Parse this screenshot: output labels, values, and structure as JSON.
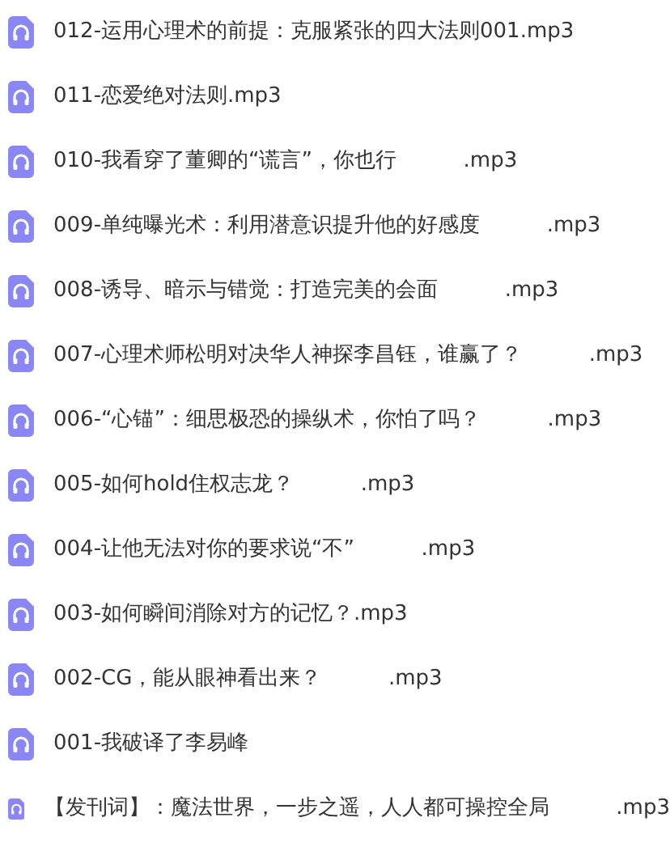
{
  "files": [
    {
      "name": "012-运用心理术的前提：克服紧张的四大法则001.mp3"
    },
    {
      "name": "011-恋爱绝对法则.mp3"
    },
    {
      "name": "010-我看穿了董卿的“谎言”，你也行          .mp3"
    },
    {
      "name": "009-单纯曝光术：利用潜意识提升他的好感度          .mp3"
    },
    {
      "name": "008-诱导、暗示与错觉：打造完美的会面          .mp3"
    },
    {
      "name": "007-心理术师松明对决华人神探李昌钰，谁赢了？          .mp3"
    },
    {
      "name": "006-“心锚”：细思极恐的操纵术，你怕了吗？          .mp3"
    },
    {
      "name": "005-如何hold住权志龙？          .mp3"
    },
    {
      "name": "004-让他无法对你的要求说“不”          .mp3"
    },
    {
      "name": "003-如何瞬间消除对方的记忆？.mp3"
    },
    {
      "name": "002-CG，能从眼神看出来？          .mp3"
    },
    {
      "name": "001-我破译了李易峰"
    },
    {
      "name": "【发刊词】：魔法世界，一步之遥，人人都可操控全局          .mp3"
    }
  ]
}
